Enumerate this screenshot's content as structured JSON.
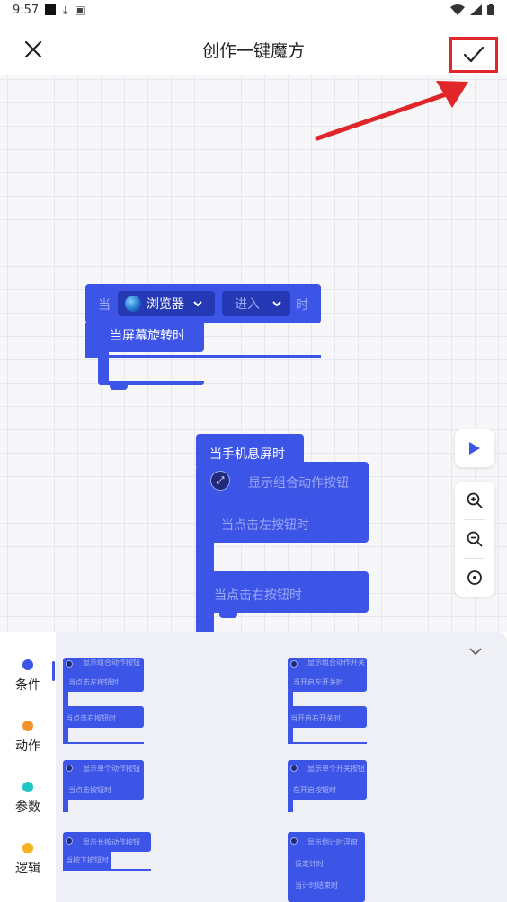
{
  "status_bar": {
    "time": "9:57"
  },
  "header": {
    "title": "创作一键魔方"
  },
  "canvas": {
    "block_rotate": {
      "prefix": "当",
      "app_dropdown": "浏览器",
      "state_dropdown": "进入",
      "suffix": "时",
      "inner": "当屏幕旋转时"
    },
    "block_screen": {
      "title": "当手机息屏时",
      "show_combo": "显示组合动作按钮",
      "left_click": "当点击左按钮时",
      "right_click": "当点击右按钮时"
    }
  },
  "categories": [
    {
      "label": "条件",
      "color": "#3d55e6"
    },
    {
      "label": "动作",
      "color": "#f5922b"
    },
    {
      "label": "参数",
      "color": "#1fc7c7"
    },
    {
      "label": "逻辑",
      "color": "#f5b320"
    }
  ],
  "palette": {
    "left": [
      "显示组合动作按钮",
      "当点击左按钮时",
      "当点击右按钮时",
      "显示单个动作按钮",
      "当点击按钮时",
      "显示长按动作按钮",
      "当按下按钮时"
    ],
    "right": [
      "显示组合动作开关",
      "当开启左开关时",
      "当开启右开关时",
      "显示单个开关按钮",
      "在开启按钮时",
      "显示倒计时浮窗",
      "设定计时",
      "当计时结束时"
    ]
  },
  "colors": {
    "block": "#3d55e6",
    "highlight": "#e0262b"
  }
}
